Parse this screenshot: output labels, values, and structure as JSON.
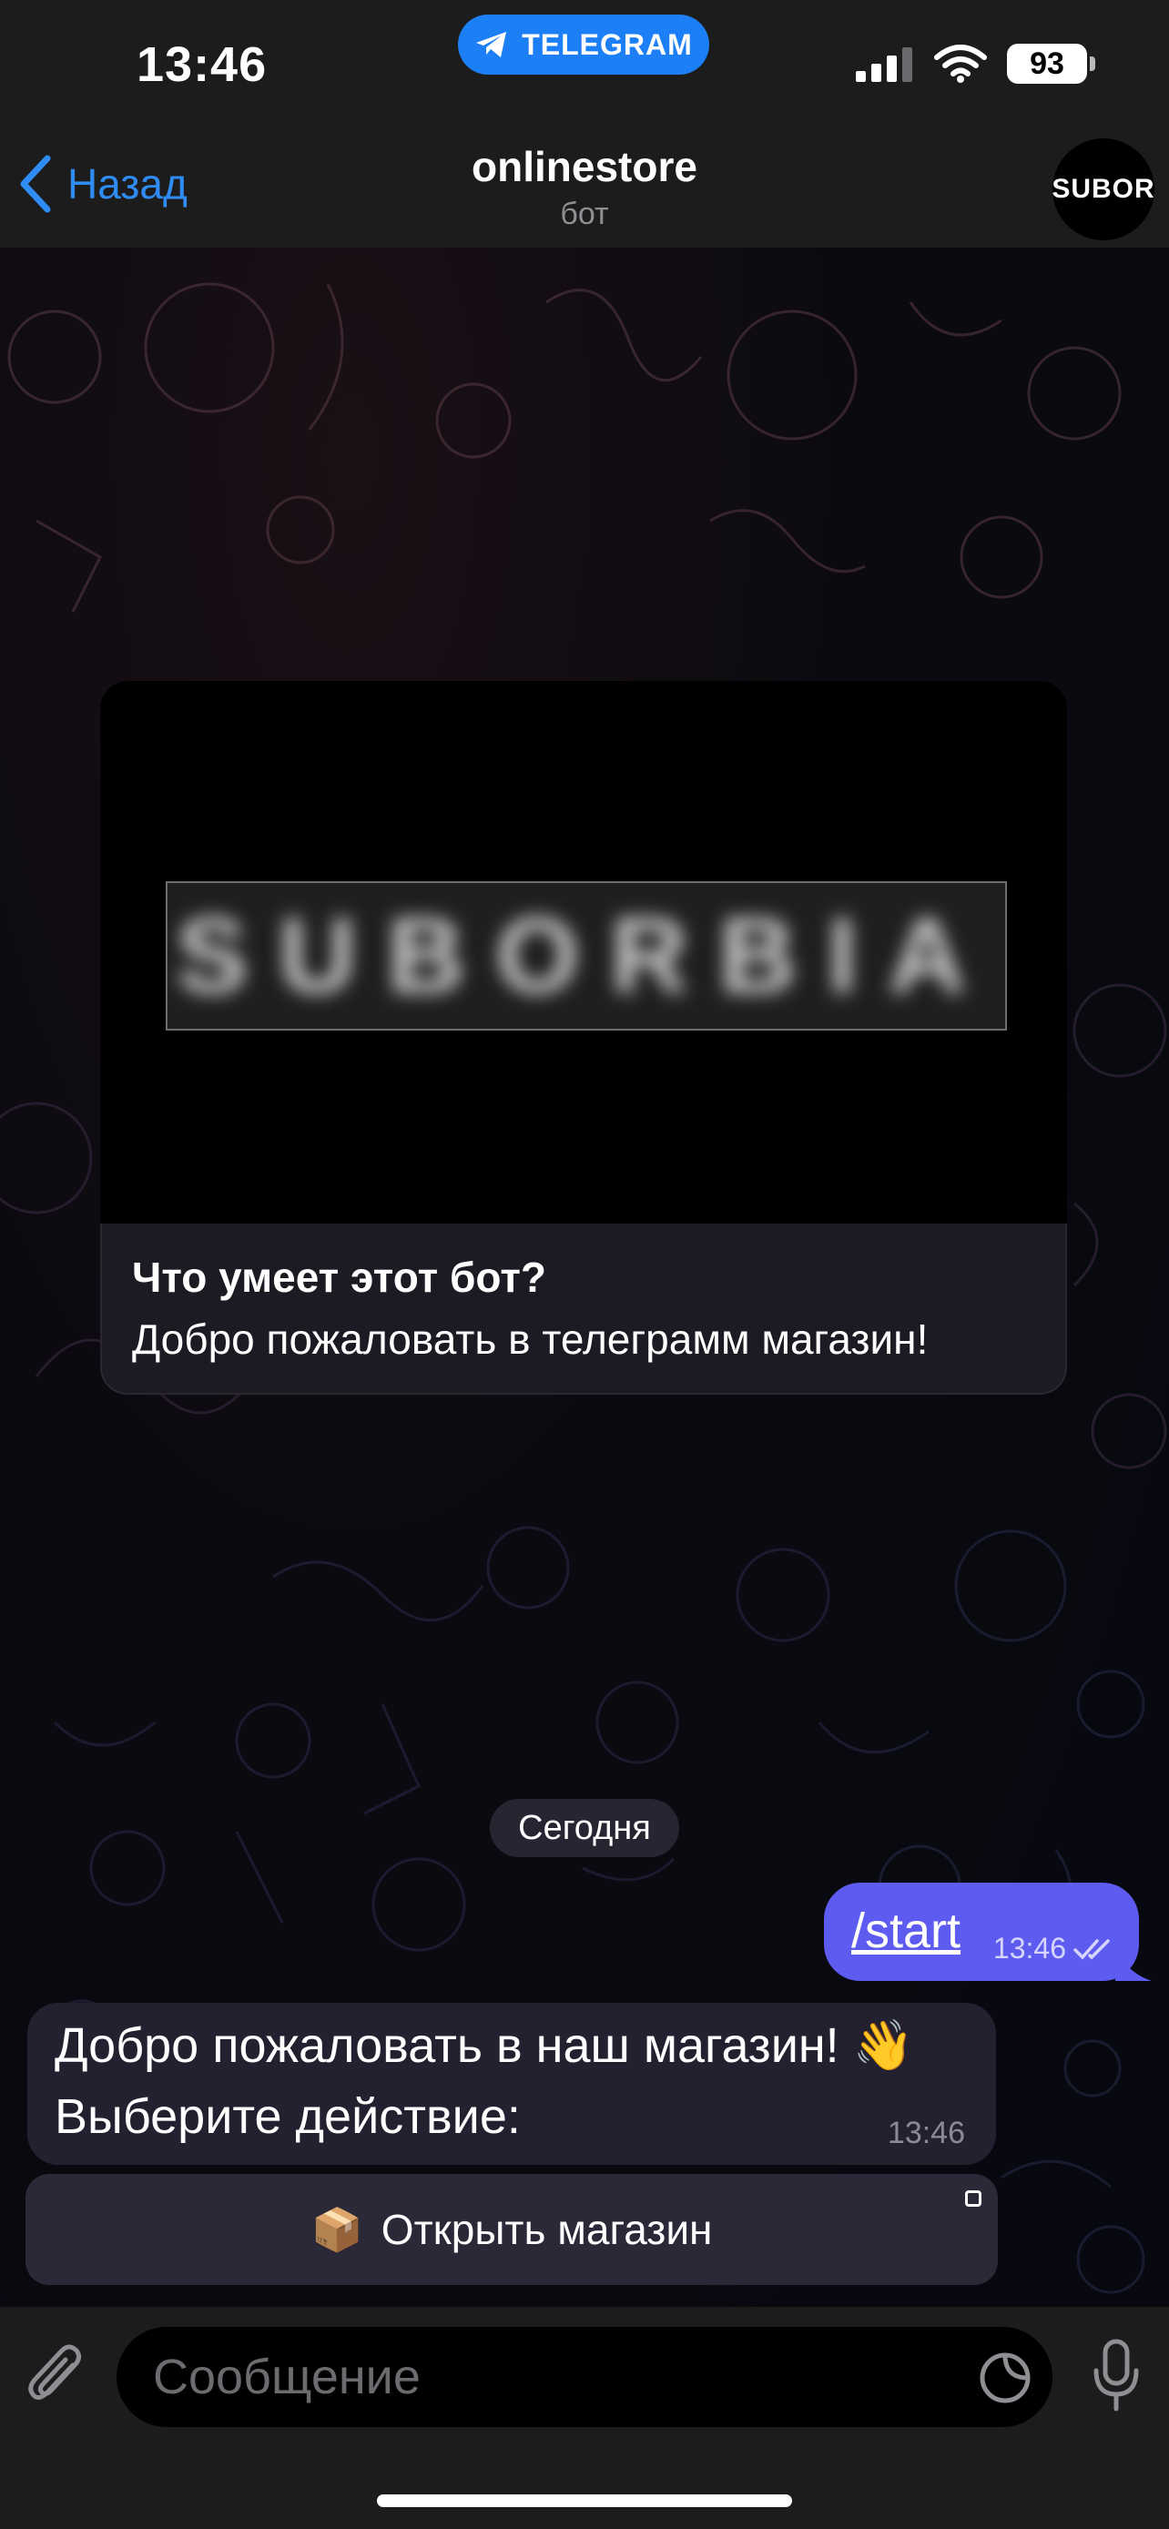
{
  "status_bar": {
    "time": "13:46",
    "app_pill": "TELEGRAM",
    "battery": "93",
    "icons": [
      "cellular-icon",
      "wifi-icon",
      "battery-icon"
    ]
  },
  "header": {
    "back_label": "Назад",
    "title": "onlinestore",
    "subtitle": "бот",
    "avatar_text": "SUBOR"
  },
  "info_card": {
    "logo_text": "SUBORBIA",
    "heading": "Что умеет этот бот?",
    "text": "Добро пожаловать в телеграмм магазин!"
  },
  "date_separator": "Сегодня",
  "messages": [
    {
      "direction": "out",
      "text": "/start",
      "time": "13:46",
      "status": "read"
    },
    {
      "direction": "in",
      "lines": [
        "Добро пожаловать в наш магазин! 👋",
        "Выберите действие:"
      ],
      "time": "13:46"
    }
  ],
  "inline_button": {
    "emoji": "📦",
    "label": "Открыть магазин"
  },
  "input": {
    "placeholder": "Сообщение",
    "value": ""
  },
  "colors": {
    "accent": "#2f8cf5",
    "outgoing_bubble": "#5e5bf0",
    "incoming_bubble": "#232130",
    "telegram_pill": "#1d7ff5"
  }
}
